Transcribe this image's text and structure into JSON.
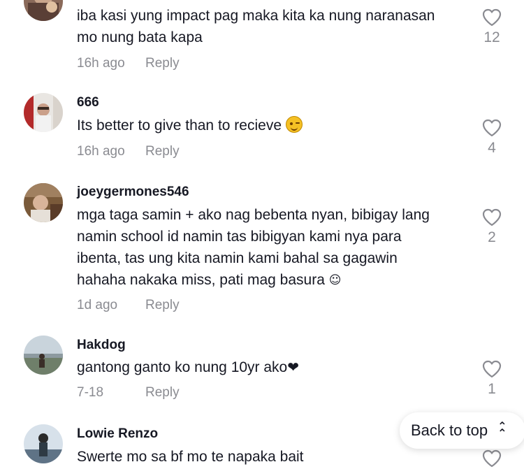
{
  "comments": [
    {
      "username": "",
      "text": "iba kasi yung impact pag maka kita ka nung naranasan mo nung bata kapa",
      "time": "16h ago",
      "reply_label": "Reply",
      "likes": "12"
    },
    {
      "username": "666",
      "text": "Its better to give than to recieve",
      "emoji": "wink-emoji",
      "time": "16h ago",
      "reply_label": "Reply",
      "likes": "4"
    },
    {
      "username": "joeygermones546",
      "text": "mga taga samin + ako nag bebenta nyan, bibigay lang namin school id namin tas bibigyan kami nya para ibenta, tas ung kita namin kami bahal sa gagawin hahaha nakaka miss, pati mag basura",
      "emoji_char": "☺",
      "time": "1d ago",
      "reply_label": "Reply",
      "likes": "2"
    },
    {
      "username": "Hakdog",
      "text": "gantong ganto ko nung 10yr ako",
      "emoji_char": "❤",
      "time": "7-18",
      "reply_label": "Reply",
      "likes": "1"
    },
    {
      "username": "Lowie Renzo",
      "text": "Swerte mo sa bf mo te napaka bait",
      "time": "",
      "reply_label": "",
      "likes": ""
    }
  ],
  "back_to_top": {
    "label": "Back to top",
    "icon": "chevron-up-double-icon"
  },
  "icons": {
    "like": "heart-outline-icon"
  },
  "colors": {
    "text": "#161823",
    "muted": "#8a8b91"
  }
}
